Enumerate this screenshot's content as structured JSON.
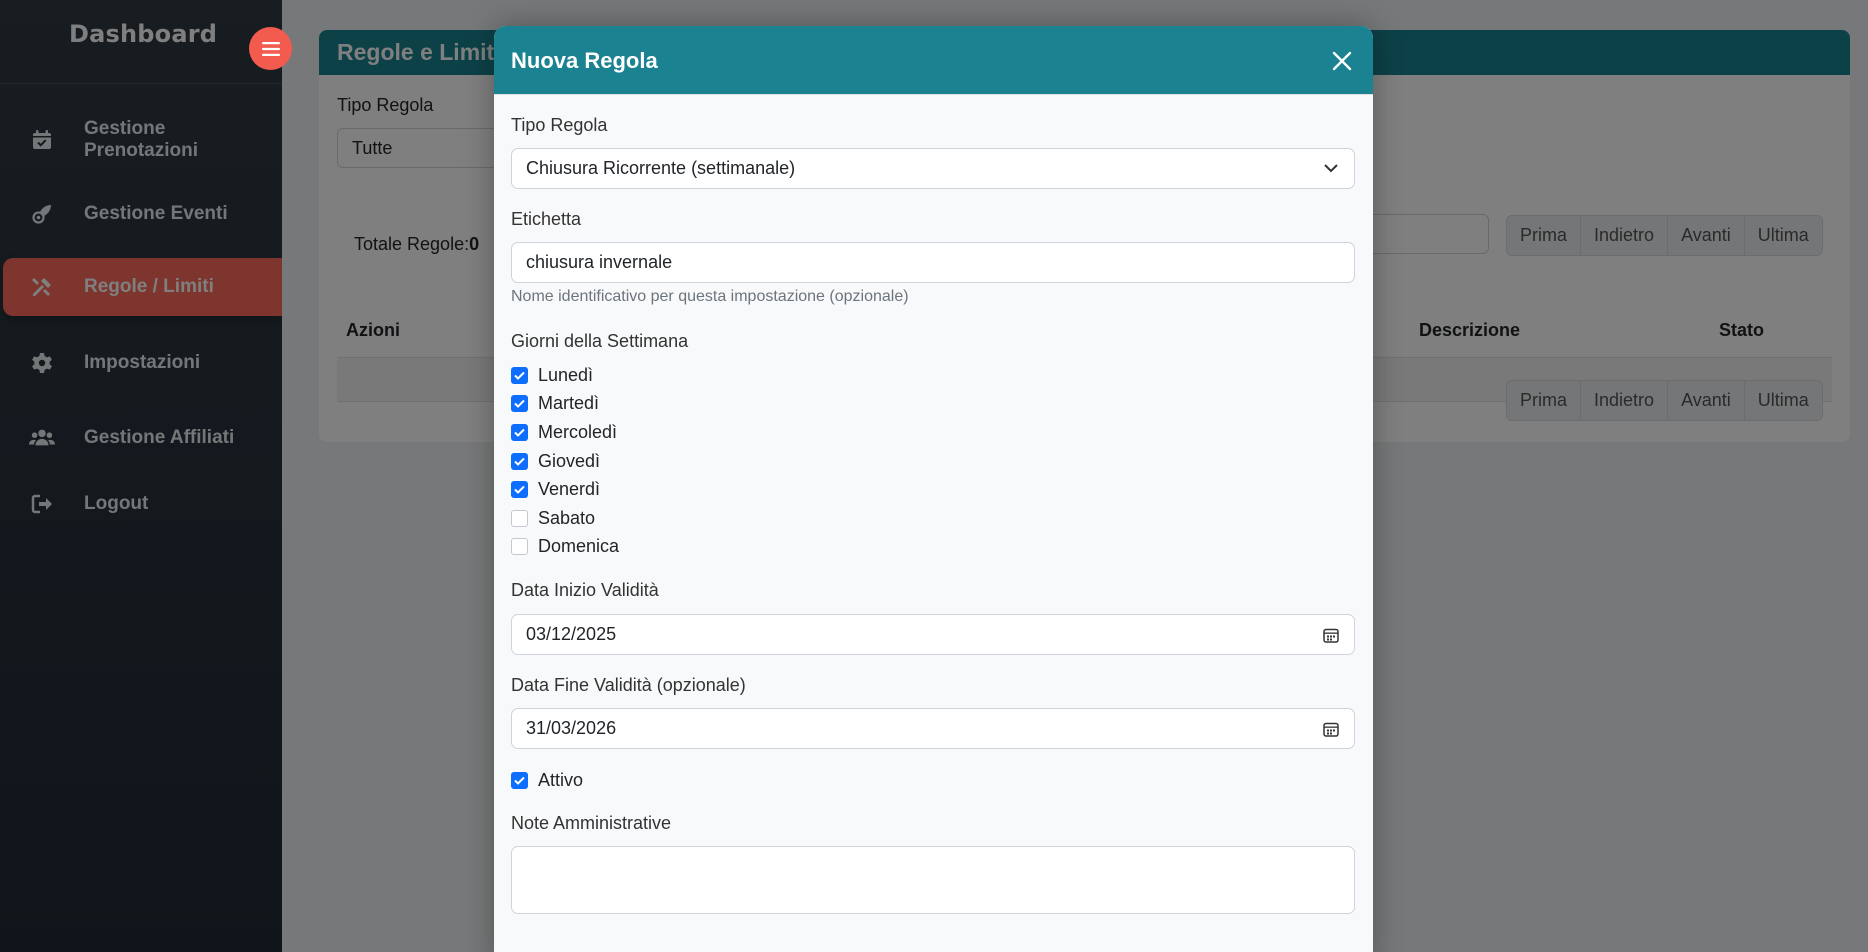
{
  "sidebar": {
    "title": "Dashboard",
    "items": [
      {
        "label": "Gestione Prenotazioni",
        "icon": "calendar-check-icon"
      },
      {
        "label": "Gestione Eventi",
        "icon": "rocket-icon"
      },
      {
        "label": "Regole / Limiti",
        "icon": "tools-icon",
        "active": true
      },
      {
        "label": "Impostazioni",
        "icon": "gear-icon"
      },
      {
        "label": "Gestione Affiliati",
        "icon": "users-icon"
      },
      {
        "label": "Logout",
        "icon": "logout-icon"
      }
    ]
  },
  "page": {
    "header_title": "Regole e Limiti",
    "filter_label": "Tipo Regola",
    "filter_value": "Tutte",
    "total_label": "Totale Regole:",
    "total_value": "0",
    "pager": [
      "Prima",
      "Indietro",
      "Avanti",
      "Ultima"
    ],
    "columns": [
      "Azioni",
      "Descrizione",
      "Stato"
    ]
  },
  "modal": {
    "title": "Nuova Regola",
    "tipo_label": "Tipo Regola",
    "tipo_value": "Chiusura Ricorrente (settimanale)",
    "etichetta_label": "Etichetta",
    "etichetta_value": "chiusura invernale",
    "etichetta_help": "Nome identificativo per questa impostazione (opzionale)",
    "giorni_label": "Giorni della Settimana",
    "giorni": [
      {
        "label": "Lunedì",
        "checked": true
      },
      {
        "label": "Martedì",
        "checked": true
      },
      {
        "label": "Mercoledì",
        "checked": true
      },
      {
        "label": "Giovedì",
        "checked": true
      },
      {
        "label": "Venerdì",
        "checked": true
      },
      {
        "label": "Sabato",
        "checked": false
      },
      {
        "label": "Domenica",
        "checked": false
      }
    ],
    "inizio_label": "Data Inizio Validità",
    "inizio_value": "03/12/2025",
    "fine_label": "Data Fine Validità (opzionale)",
    "fine_value": "31/03/2026",
    "attivo_label": "Attivo",
    "attivo_checked": true,
    "note_label": "Note Amministrative",
    "note_value": ""
  },
  "colors": {
    "teal": "#1a8290",
    "accent": "#fb6b5b",
    "checkbox": "#0d6efd"
  }
}
